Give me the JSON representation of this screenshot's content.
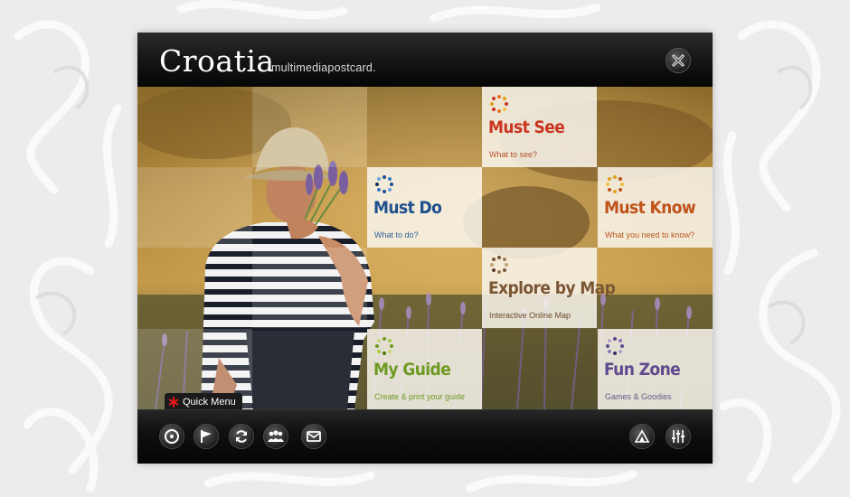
{
  "app": {
    "title": "Croatia",
    "subtitle": "multimediapostcard."
  },
  "tiles": [
    {
      "key": "must-see",
      "title": "Must See",
      "subtitle": "What to see?",
      "color": "#c8341e",
      "sub_color": "#b8502a",
      "icon": "dots-ring-icon"
    },
    {
      "key": "must-do",
      "title": "Must Do",
      "subtitle": "What to do?",
      "color": "#1d4f8e",
      "sub_color": "#2f5f9a",
      "icon": "dots-ring-icon"
    },
    {
      "key": "must-know",
      "title": "Must Know",
      "subtitle": "What you need to know?",
      "color": "#c0521a",
      "sub_color": "#b9561e",
      "icon": "dots-ring-icon"
    },
    {
      "key": "explore-by-map",
      "title": "Explore by Map",
      "subtitle": "Interactive Online Map",
      "color": "#7a5634",
      "sub_color": "#6b4a2c",
      "icon": "dots-ring-icon"
    },
    {
      "key": "my-guide",
      "title": "My Guide",
      "subtitle": "Create & print your guide",
      "color": "#6e9a22",
      "sub_color": "#6f9a22",
      "icon": "dots-ring-icon"
    },
    {
      "key": "fun-zone",
      "title": "Fun Zone",
      "subtitle": "Games & Goodies",
      "color": "#5d4a8c",
      "sub_color": "#6a5a8a",
      "icon": "dots-ring-icon"
    }
  ],
  "quick_menu": {
    "label": "Quick Menu",
    "icon": "asterisk-icon",
    "accent": "#e01818"
  },
  "footer": {
    "left_buttons": [
      "disc-icon",
      "flag-icon",
      "refresh-icon",
      "people-icon",
      "postcard-icon"
    ],
    "right_buttons": [
      "sound-icon",
      "equalizer-icon"
    ]
  },
  "header": {
    "close_icon": "close-icon"
  }
}
